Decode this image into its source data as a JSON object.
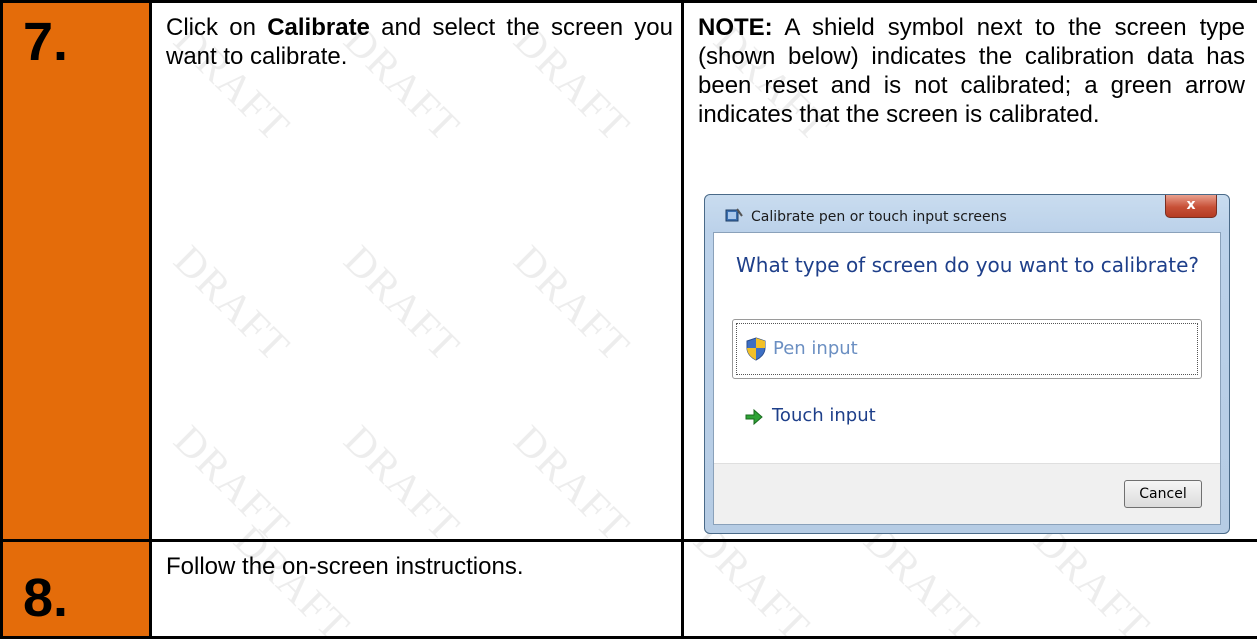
{
  "watermark": "DRAFT",
  "steps": [
    {
      "number": "7.",
      "instruction_pre": "Click on ",
      "instruction_bold": "Calibrate",
      "instruction_post": " and select the screen you want to calibrate.",
      "note_label": "NOTE:",
      "note_text": " A shield symbol next to the screen type (shown below) indicates the calibration data has been reset and is not calibrated; a green arrow indicates that the screen is calibrated."
    },
    {
      "number": "8.",
      "instruction": "Follow the on-screen instructions."
    }
  ],
  "dialog": {
    "title": "Calibrate pen or touch input screens",
    "close_label": "x",
    "question": "What type of screen do you want to calibrate?",
    "options": [
      {
        "label": "Pen input",
        "icon": "shield-icon"
      },
      {
        "label": "Touch input",
        "icon": "green-arrow-icon"
      }
    ],
    "cancel_label": "Cancel"
  },
  "colors": {
    "step_number_bg": "#e46c0a",
    "question_text": "#1e3f8a",
    "pen_text": "#6b8fc2"
  }
}
